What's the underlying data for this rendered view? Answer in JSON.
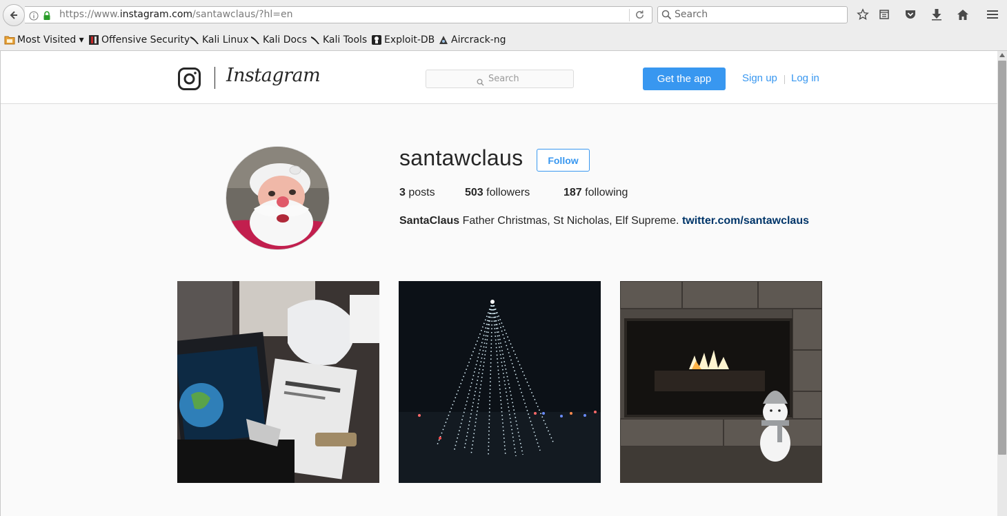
{
  "browser": {
    "url_prefix": "https://www.",
    "url_domain": "instagram.com",
    "url_path": "/santawclaus/?hl=en",
    "search_placeholder": "Search",
    "bookmarks": [
      {
        "label": "Most Visited ▾"
      },
      {
        "label": "Offensive Security"
      },
      {
        "label": "Kali Linux"
      },
      {
        "label": "Kali Docs"
      },
      {
        "label": "Kali Tools"
      },
      {
        "label": "Exploit-DB"
      },
      {
        "label": "Aircrack-ng"
      }
    ]
  },
  "header": {
    "wordmark": "Instagram",
    "search_placeholder": "Search",
    "get_app": "Get the app",
    "sign_up": "Sign up",
    "log_in": "Log in"
  },
  "profile": {
    "username": "santawclaus",
    "follow": "Follow",
    "posts_count": "3",
    "posts_label": "posts",
    "followers_count": "503",
    "followers_label": "followers",
    "following_count": "187",
    "following_label": "following",
    "bio_name": "SantaClaus",
    "bio_text": "Father Christmas, St Nicholas, Elf Supreme.",
    "bio_link": "twitter.com/santawclaus"
  },
  "colors": {
    "accent": "#3897f0",
    "link_dark": "#003569"
  }
}
